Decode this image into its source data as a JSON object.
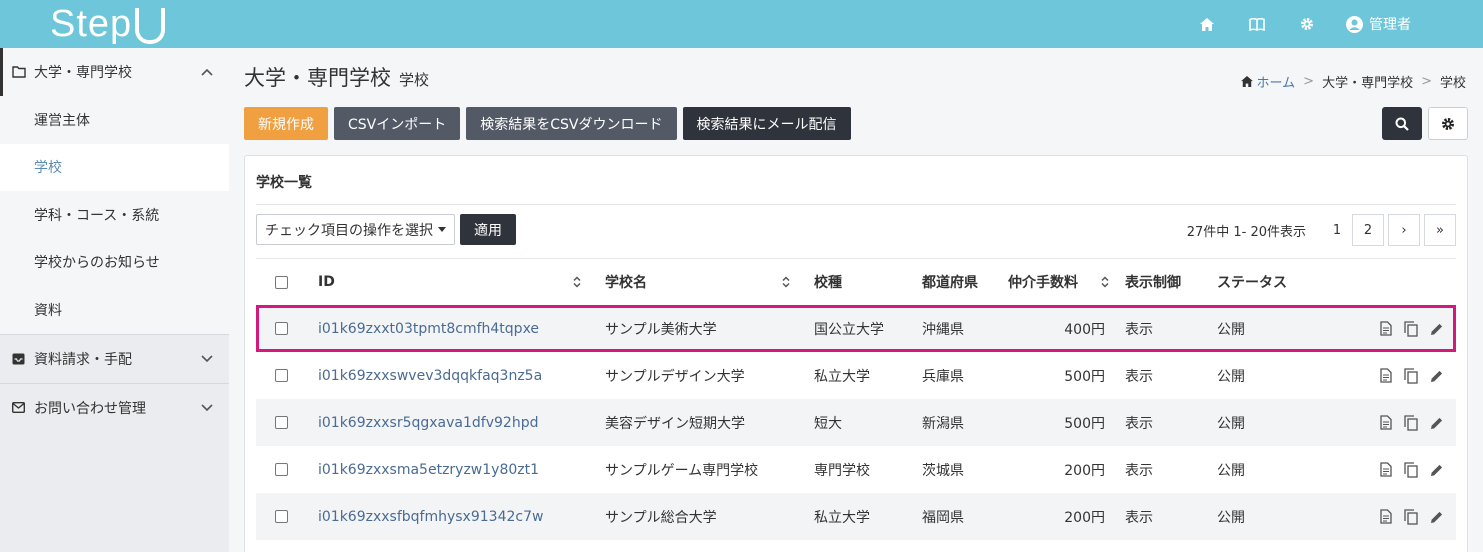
{
  "header": {
    "logo_text": "Step",
    "user_label": "管理者",
    "icons": [
      "home-icon",
      "book-icon",
      "gear-icon",
      "user-circle-icon"
    ]
  },
  "sidebar": {
    "groups": [
      {
        "label": "大学・専門学校",
        "icon": "folder-icon",
        "expanded": true,
        "items": [
          {
            "label": "運営主体"
          },
          {
            "label": "学校",
            "current": true
          },
          {
            "label": "学科・コース・系統"
          },
          {
            "label": "学校からのお知らせ"
          },
          {
            "label": "資料"
          }
        ]
      },
      {
        "label": "資料請求・手配",
        "icon": "inbox-icon",
        "expanded": false
      },
      {
        "label": "お問い合わせ管理",
        "icon": "mail-icon",
        "expanded": false
      }
    ]
  },
  "page": {
    "title": "大学・専門学校",
    "subtitle": "学校"
  },
  "breadcrumb": {
    "home": "ホーム",
    "level1": "大学・専門学校",
    "current": "学校"
  },
  "toolbar": {
    "new_label": "新規作成",
    "csv_import_label": "CSVインポート",
    "csv_download_label": "検索結果をCSVダウンロード",
    "mail_label": "検索結果にメール配信"
  },
  "panel": {
    "title": "学校一覧",
    "bulk_select": "チェック項目の操作を選択",
    "apply_label": "適用",
    "pager": {
      "count_text": "27件中 1- 20件表示",
      "current_page": "1",
      "next_page": "2",
      "next": "›",
      "last": "»"
    }
  },
  "table": {
    "headers": {
      "id": "ID",
      "name": "学校名",
      "type": "校種",
      "pref": "都道府県",
      "fee": "仲介手数料",
      "display": "表示制御",
      "status": "ステータス"
    },
    "rows": [
      {
        "id": "i01k69zxxt03tpmt8cmfh4tqpxe",
        "name": "サンプル美術大学",
        "type": "国公立大学",
        "pref": "沖縄県",
        "fee": "400円",
        "display": "表示",
        "status": "公開"
      },
      {
        "id": "i01k69zxxswvev3dqqkfaq3nz5a",
        "name": "サンプルデザイン大学",
        "type": "私立大学",
        "pref": "兵庫県",
        "fee": "500円",
        "display": "表示",
        "status": "公開"
      },
      {
        "id": "i01k69zxxsr5qgxava1dfv92hpd",
        "name": "美容デザイン短期大学",
        "type": "短大",
        "pref": "新潟県",
        "fee": "500円",
        "display": "表示",
        "status": "公開"
      },
      {
        "id": "i01k69zxxsma5etzryzw1y80zt1",
        "name": "サンプルゲーム専門学校",
        "type": "専門学校",
        "pref": "茨城県",
        "fee": "200円",
        "display": "表示",
        "status": "公開"
      },
      {
        "id": "i01k69zxxsfbqfmhysx91342c7w",
        "name": "サンプル総合大学",
        "type": "私立大学",
        "pref": "福岡県",
        "fee": "200円",
        "display": "表示",
        "status": "公開"
      }
    ],
    "highlighted_row": 0
  },
  "colors": {
    "header_bg": "#6ec6da",
    "primary_orange": "#f0a041",
    "highlight": "#d4187c",
    "link": "#4a6b93"
  }
}
